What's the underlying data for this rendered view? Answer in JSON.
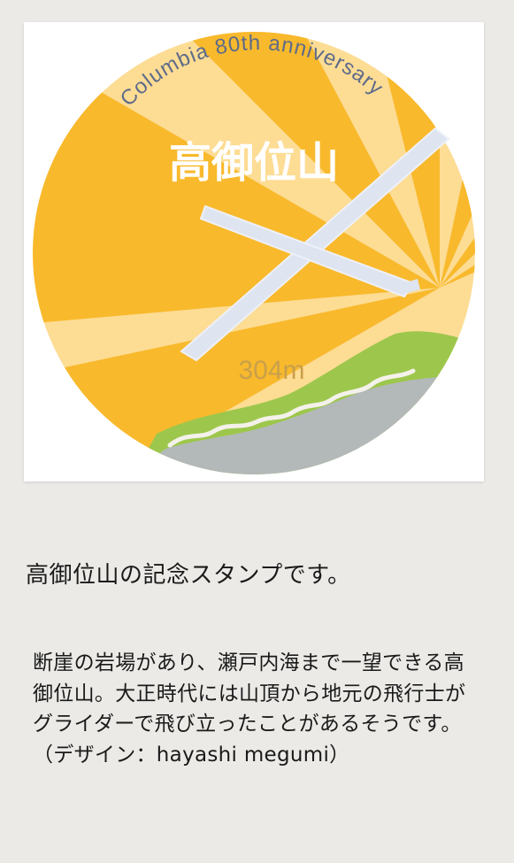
{
  "stamp": {
    "arc_text": "Columbia 80th anniversary",
    "mountain_name": "高御位山",
    "elevation": "304m",
    "colors": {
      "sun_dark": "#f8b92c",
      "sun_light": "#fddc94",
      "glider": "#dfe4f1",
      "hill_green": "#9dc74c",
      "hill_grey": "#b3b9b8",
      "arc_text": "#5d6b8a"
    }
  },
  "caption": "高御位山の記念スタンプです。",
  "description": "断崖の岩場があり、瀬戸内海まで一望できる高御位山。大正時代には山頂から地元の飛行士がグライダーで飛び立ったことがあるそうです。（デザイン：hayashi megumi）"
}
